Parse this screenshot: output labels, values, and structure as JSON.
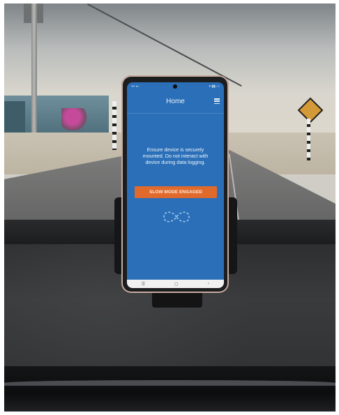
{
  "screen": {
    "title": "Home",
    "message": "Ensure device is securely mounted. Do not interact with device during data logging.",
    "status_button_label": "SLOW MODE ENGAGED",
    "icons": {
      "menu": "hamburger-menu-icon",
      "loader": "infinity-loading-icon",
      "nav_recent": "recent-apps-icon",
      "nav_home": "home-icon",
      "nav_back": "back-icon"
    },
    "colors": {
      "screen_background": "#2a6fb8",
      "button": "#e06a2c"
    }
  }
}
